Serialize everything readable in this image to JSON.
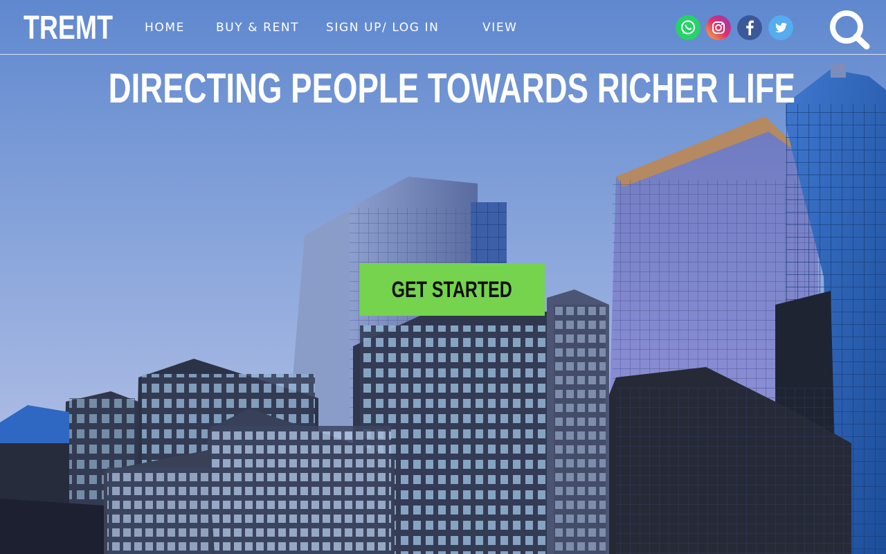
{
  "brand": {
    "logo_text": "TREMT"
  },
  "nav": {
    "items": [
      {
        "label": "HOME"
      },
      {
        "label": "BUY & RENT"
      },
      {
        "label": "SIGN UP/ LOG IN"
      },
      {
        "label": "VIEW"
      }
    ]
  },
  "social": [
    {
      "icon": "whatsapp-icon",
      "color": "#25d366"
    },
    {
      "icon": "instagram-icon",
      "color": "#d6249f"
    },
    {
      "icon": "facebook-icon",
      "color": "#3b5998"
    },
    {
      "icon": "twitter-icon",
      "color": "#55acee"
    }
  ],
  "search": {
    "icon": "search-icon"
  },
  "hero": {
    "headline": "DIRECTING PEOPLE TOWARDS RICHER LIFE",
    "cta_label": "GET STARTED",
    "cta_color": "#75d34e"
  }
}
